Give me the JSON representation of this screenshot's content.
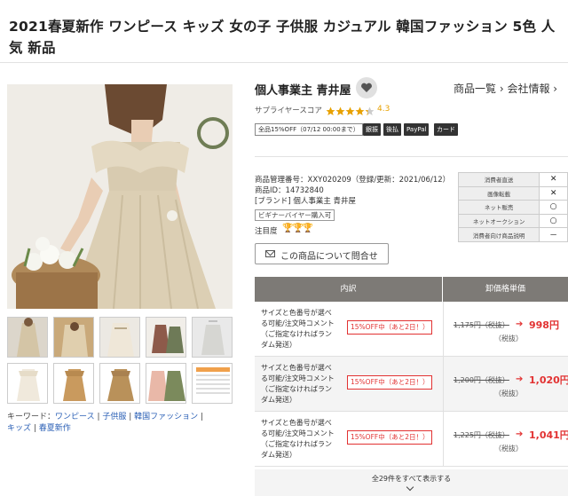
{
  "product": {
    "title": "2021春夏新作 ワンピース キッズ 女の子 子供服 カジュアル 韓国ファッション 5色 人気 新品"
  },
  "gallery": {
    "main_image": "girl-in-linen-dress-photo",
    "thumbnails": [
      "thumb-girl-beige-dress",
      "thumb-beige-dress-detail",
      "thumb-dress-back-view",
      "thumb-dress-flatlay",
      "thumb-dress-hanger",
      "thumb-white-dress",
      "thumb-tan-dress",
      "thumb-brown-dress",
      "thumb-pink-green-dresses",
      "thumb-size-chart"
    ]
  },
  "keywords": {
    "label": "キーワード：",
    "items": [
      "ワンピース",
      "子供服",
      "韓国ファッション",
      "キッズ",
      "春夏新作"
    ]
  },
  "shop": {
    "name": "個人事業主 青井屋",
    "fav_icon": "heart-icon",
    "links": [
      "商品一覧",
      "会社情報"
    ],
    "score_label": "サプライヤースコア",
    "score": "4.3",
    "stars": 4.3
  },
  "badges": {
    "sale": "全品15%OFF（07/12 00:00まで）",
    "payments": [
      "銀振",
      "後払",
      "PayPal",
      "カード"
    ]
  },
  "product_info": {
    "code": "商品管理番号：XXY020209（登録/更新：2021/06/12）",
    "id": "商品ID：14732840",
    "brand": "[ブランド] 個人事業主 青井屋",
    "beginner_badge": "ビギナーバイヤー購入可",
    "attention_label": "注目度",
    "attention_icons": "🏆🏆🏆",
    "inquiry_button": "この商品について問合せ"
  },
  "features": [
    {
      "label": "消費者直送",
      "value": "✕"
    },
    {
      "label": "画像転載",
      "value": "✕"
    },
    {
      "label": "ネット販売",
      "value": "○"
    },
    {
      "label": "ネットオークション",
      "value": "○"
    },
    {
      "label": "消費者向け商品説明",
      "value": "－"
    }
  ],
  "price_table": {
    "headers": [
      "内訳",
      "卸価格単価"
    ],
    "rows": [
      {
        "desc": "サイズと色番号が選べる可能/注文時コメント（ご指定なければランダム発送）",
        "discount": "15%OFF中（あと2日！）",
        "old": "1,175円（税抜）",
        "arrow": "➔",
        "new": "998円",
        "tax": "（税抜）"
      },
      {
        "desc": "サイズと色番号が選べる可能/注文時コメント（ご指定なければランダム発送）",
        "discount": "15%OFF中（あと2日！）",
        "old": "1,200円（税抜）",
        "arrow": "➔",
        "new": "1,020円",
        "tax": "（税抜）"
      },
      {
        "desc": "サイズと色番号が選べる可能/注文時コメント（ご指定なければランダム発送）",
        "discount": "15%OFF中（あと2日！）",
        "old": "1,225円（税抜）",
        "arrow": "➔",
        "new": "1,041円",
        "tax": "（税抜）"
      }
    ],
    "show_all": "全29件をすべて表示する"
  },
  "colors": {
    "accent_red": "#e23232",
    "star_gold": "#e8a100",
    "link_blue": "#2a5fb5",
    "table_header": "#7d7a76"
  }
}
